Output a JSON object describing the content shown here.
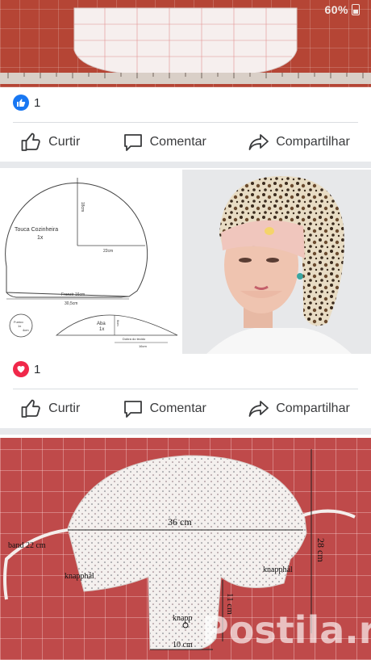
{
  "status_bar": {
    "battery_percent": "60%"
  },
  "post1": {
    "reaction_count": "1",
    "reaction_type": "like"
  },
  "post2": {
    "reaction_count": "1",
    "reaction_type": "love",
    "pattern": {
      "title": "Touca Cozinheira",
      "title_qty": "1x",
      "vertical_measure": "18cm",
      "radius_measure": "22cm",
      "band_label": "Franzir 16cm",
      "base_measure": "30,5cm",
      "button_label": "Fuxico",
      "button_qty": "1x",
      "button_size": "4cm",
      "brim_title": "Aba",
      "brim_qty": "1x",
      "brim_height": "6cm",
      "brim_fold": "Dobra do tecido",
      "brim_length": "16cm"
    }
  },
  "post3": {
    "width_label": "36 cm",
    "height_label": "28 cm",
    "band_label": "band 22 cm",
    "buttonhole_left": "knapphål",
    "buttonhole_right": "knapphål",
    "flap_height": "11 cm",
    "button_label": "knapp",
    "flap_width": "10 cm",
    "watermark": "Postila.ru"
  },
  "actions": {
    "like": "Curtir",
    "comment": "Comentar",
    "share": "Compartilhar"
  },
  "icons": {
    "like": "thumbs-up-icon",
    "comment": "comment-bubble-icon",
    "share": "share-arrow-icon",
    "like_reaction": "like-reaction-icon",
    "love_reaction": "love-reaction-icon"
  },
  "colors": {
    "facebook_blue": "#1877f2",
    "love_red": "#f0284a",
    "text": "#3a3b3d"
  }
}
